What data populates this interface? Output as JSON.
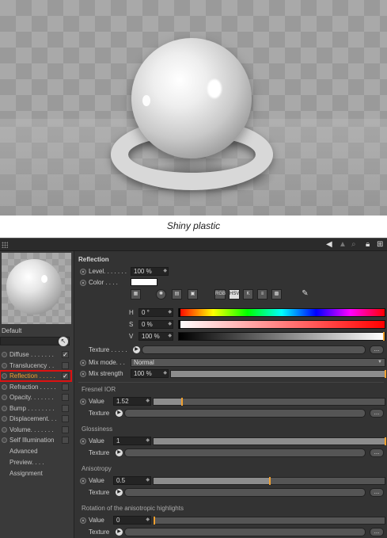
{
  "caption": "Shiny plastic",
  "preview": {
    "material_name": "Default"
  },
  "channels": [
    {
      "label": "Diffuse . . . . . . .",
      "checked": true,
      "active": false
    },
    {
      "label": "Translucency . .",
      "checked": false,
      "active": false
    },
    {
      "label": "Reflection . . . . .",
      "checked": true,
      "active": true
    },
    {
      "label": "Refraction . . . . .",
      "checked": false,
      "active": false
    },
    {
      "label": "Opacity. . . . . . .",
      "checked": false,
      "active": false
    },
    {
      "label": "Bump . . . . . . . .",
      "checked": false,
      "active": false
    },
    {
      "label": "Displacement. . .",
      "checked": false,
      "active": false
    },
    {
      "label": "Volume. . . . . . .",
      "checked": false,
      "active": false
    },
    {
      "label": "Self Illumination",
      "checked": false,
      "active": false
    }
  ],
  "nav": [
    "Advanced",
    "Preview. . . .",
    "Assignment"
  ],
  "reflection": {
    "title": "Reflection",
    "level_label": "Level. . . . . . .",
    "level_value": "100 %",
    "color_label": "Color . . . .",
    "texture_label": "Texture . . . . .",
    "hsv": {
      "h_label": "H",
      "h_value": "0 °",
      "s_label": "S",
      "s_value": "0 %",
      "v_label": "V",
      "v_value": "100 %"
    },
    "icons": [
      "RGB",
      "HSV"
    ],
    "mix_mode_label": "Mix mode. . .",
    "mix_mode_value": "Normal",
    "mix_strength_label": "Mix strength",
    "mix_strength_value": "100 %"
  },
  "fresnel": {
    "title": "Fresnel IOR",
    "value_label": "Value",
    "value": "1.52",
    "level": 0.12,
    "texture_label": "Texture"
  },
  "glossiness": {
    "title": "Glossiness",
    "value_label": "Value",
    "value": "1",
    "level": 1.0,
    "texture_label": "Texture"
  },
  "anisotropy": {
    "title": "Anisotropy",
    "value_label": "Value",
    "value": "0.5",
    "level": 0.5,
    "texture_label": "Texture"
  },
  "rotation": {
    "title": "Rotation of the anisotropic highlights",
    "value_label": "Value",
    "value": "0",
    "level": 0.0,
    "texture_label": "Texture"
  },
  "colors": {
    "accent": "#f0a030",
    "highlight_box": "#dd1111"
  }
}
